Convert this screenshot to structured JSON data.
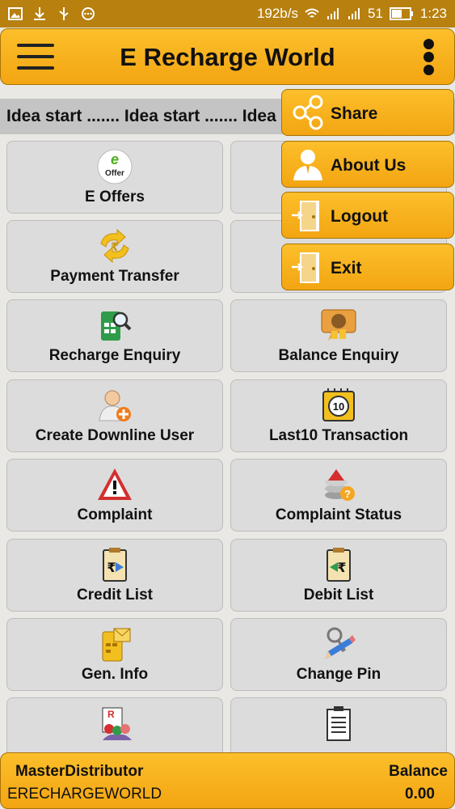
{
  "status_bar": {
    "speed": "192b/s",
    "battery": "51",
    "time": "1:23"
  },
  "app_bar": {
    "title": "E Recharge World"
  },
  "marquee": {
    "text": "Idea start ....... Idea start ....... Idea start ......."
  },
  "tiles": [
    {
      "label": "E Offers",
      "icon": "offer-icon"
    },
    {
      "label": "",
      "icon": "hidden-icon"
    },
    {
      "label": "Payment Transfer",
      "icon": "payment-transfer-icon"
    },
    {
      "label": "",
      "icon": "hidden-icon"
    },
    {
      "label": "Recharge Enquiry",
      "icon": "recharge-enquiry-icon"
    },
    {
      "label": "Balance Enquiry",
      "icon": "balance-enquiry-icon"
    },
    {
      "label": "Create Downline User",
      "icon": "create-user-icon"
    },
    {
      "label": "Last10 Transaction",
      "icon": "last10-icon"
    },
    {
      "label": "Complaint",
      "icon": "warning-icon"
    },
    {
      "label": "Complaint Status",
      "icon": "complaint-status-icon"
    },
    {
      "label": "Credit List",
      "icon": "credit-list-icon"
    },
    {
      "label": "Debit List",
      "icon": "debit-list-icon"
    },
    {
      "label": "Gen. Info",
      "icon": "gen-info-icon"
    },
    {
      "label": "Change Pin",
      "icon": "change-pin-icon"
    },
    {
      "label": "",
      "icon": "users-report-icon"
    },
    {
      "label": "",
      "icon": "report-icon"
    }
  ],
  "overflow_menu": [
    {
      "label": "Share",
      "icon": "share-icon"
    },
    {
      "label": "About Us",
      "icon": "user-icon"
    },
    {
      "label": "Logout",
      "icon": "door-icon"
    },
    {
      "label": "Exit",
      "icon": "door-icon"
    }
  ],
  "footer": {
    "role": "MasterDistributor",
    "username": "ERECHARGEWORLD",
    "balance_label": "Balance",
    "balance_value": "0.00"
  },
  "colors": {
    "accent": "#f7ae1a",
    "status_bar": "#b7800f",
    "tile": "#dcdcdc"
  }
}
